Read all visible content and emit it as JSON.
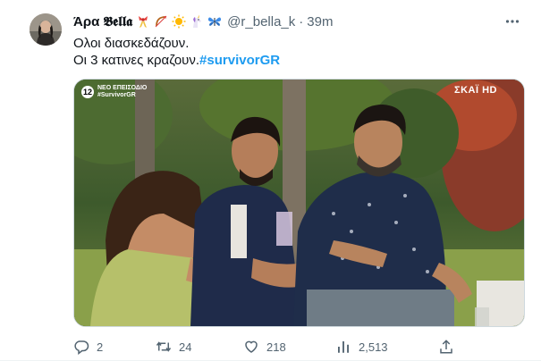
{
  "tweet": {
    "display_name": "Άρα 𝕭𝖊𝖑𝖑𝖆",
    "name_emojis": [
      "ribbon-emoji",
      "bow-and-arrow-emoji",
      "sun-emoji",
      "unicorn-emoji",
      "butterfly-emoji"
    ],
    "handle": "@r_bella_k",
    "separator": "·",
    "time": "39m",
    "text_line1": "Ολοι διασκεδάζουν.",
    "text_line2": "Οι 3 κατινες κραζουν.",
    "hashtag": "#survivorGR"
  },
  "media": {
    "rating": "12",
    "overlay_line1": "ΝΕΟ ΕΠΕΙΣΟΔΙΟ",
    "overlay_line2": "#SurvivorGR",
    "channel": "ΣΚΑΪ HD"
  },
  "actions": {
    "replies": "2",
    "retweets": "24",
    "likes": "218",
    "views": "2,513"
  },
  "colors": {
    "accent": "#1d9bf0",
    "muted": "#536471",
    "text": "#0f1419"
  }
}
